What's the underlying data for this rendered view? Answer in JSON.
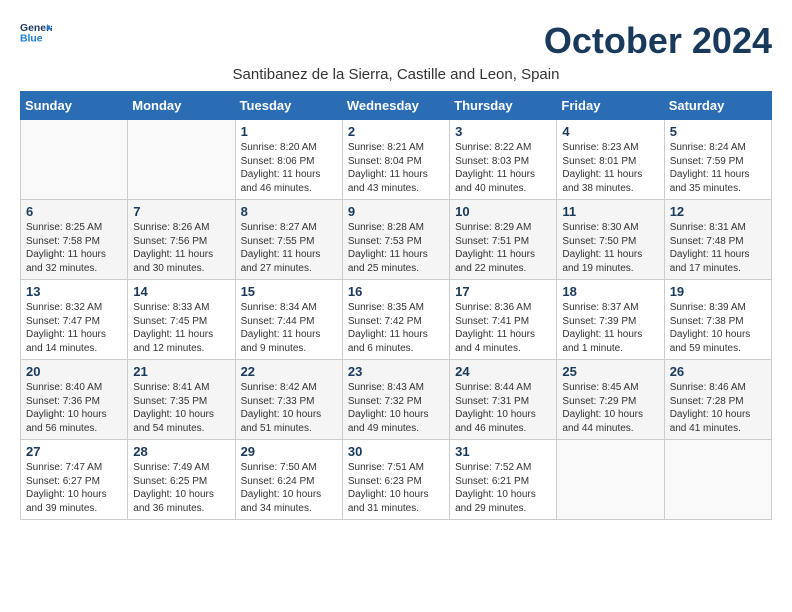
{
  "header": {
    "logo_general": "General",
    "logo_blue": "Blue",
    "month_title": "October 2024",
    "location": "Santibanez de la Sierra, Castille and Leon, Spain"
  },
  "days_of_week": [
    "Sunday",
    "Monday",
    "Tuesday",
    "Wednesday",
    "Thursday",
    "Friday",
    "Saturday"
  ],
  "weeks": [
    [
      {
        "day": "",
        "content": ""
      },
      {
        "day": "",
        "content": ""
      },
      {
        "day": "1",
        "content": "Sunrise: 8:20 AM\nSunset: 8:06 PM\nDaylight: 11 hours and 46 minutes."
      },
      {
        "day": "2",
        "content": "Sunrise: 8:21 AM\nSunset: 8:04 PM\nDaylight: 11 hours and 43 minutes."
      },
      {
        "day": "3",
        "content": "Sunrise: 8:22 AM\nSunset: 8:03 PM\nDaylight: 11 hours and 40 minutes."
      },
      {
        "day": "4",
        "content": "Sunrise: 8:23 AM\nSunset: 8:01 PM\nDaylight: 11 hours and 38 minutes."
      },
      {
        "day": "5",
        "content": "Sunrise: 8:24 AM\nSunset: 7:59 PM\nDaylight: 11 hours and 35 minutes."
      }
    ],
    [
      {
        "day": "6",
        "content": "Sunrise: 8:25 AM\nSunset: 7:58 PM\nDaylight: 11 hours and 32 minutes."
      },
      {
        "day": "7",
        "content": "Sunrise: 8:26 AM\nSunset: 7:56 PM\nDaylight: 11 hours and 30 minutes."
      },
      {
        "day": "8",
        "content": "Sunrise: 8:27 AM\nSunset: 7:55 PM\nDaylight: 11 hours and 27 minutes."
      },
      {
        "day": "9",
        "content": "Sunrise: 8:28 AM\nSunset: 7:53 PM\nDaylight: 11 hours and 25 minutes."
      },
      {
        "day": "10",
        "content": "Sunrise: 8:29 AM\nSunset: 7:51 PM\nDaylight: 11 hours and 22 minutes."
      },
      {
        "day": "11",
        "content": "Sunrise: 8:30 AM\nSunset: 7:50 PM\nDaylight: 11 hours and 19 minutes."
      },
      {
        "day": "12",
        "content": "Sunrise: 8:31 AM\nSunset: 7:48 PM\nDaylight: 11 hours and 17 minutes."
      }
    ],
    [
      {
        "day": "13",
        "content": "Sunrise: 8:32 AM\nSunset: 7:47 PM\nDaylight: 11 hours and 14 minutes."
      },
      {
        "day": "14",
        "content": "Sunrise: 8:33 AM\nSunset: 7:45 PM\nDaylight: 11 hours and 12 minutes."
      },
      {
        "day": "15",
        "content": "Sunrise: 8:34 AM\nSunset: 7:44 PM\nDaylight: 11 hours and 9 minutes."
      },
      {
        "day": "16",
        "content": "Sunrise: 8:35 AM\nSunset: 7:42 PM\nDaylight: 11 hours and 6 minutes."
      },
      {
        "day": "17",
        "content": "Sunrise: 8:36 AM\nSunset: 7:41 PM\nDaylight: 11 hours and 4 minutes."
      },
      {
        "day": "18",
        "content": "Sunrise: 8:37 AM\nSunset: 7:39 PM\nDaylight: 11 hours and 1 minute."
      },
      {
        "day": "19",
        "content": "Sunrise: 8:39 AM\nSunset: 7:38 PM\nDaylight: 10 hours and 59 minutes."
      }
    ],
    [
      {
        "day": "20",
        "content": "Sunrise: 8:40 AM\nSunset: 7:36 PM\nDaylight: 10 hours and 56 minutes."
      },
      {
        "day": "21",
        "content": "Sunrise: 8:41 AM\nSunset: 7:35 PM\nDaylight: 10 hours and 54 minutes."
      },
      {
        "day": "22",
        "content": "Sunrise: 8:42 AM\nSunset: 7:33 PM\nDaylight: 10 hours and 51 minutes."
      },
      {
        "day": "23",
        "content": "Sunrise: 8:43 AM\nSunset: 7:32 PM\nDaylight: 10 hours and 49 minutes."
      },
      {
        "day": "24",
        "content": "Sunrise: 8:44 AM\nSunset: 7:31 PM\nDaylight: 10 hours and 46 minutes."
      },
      {
        "day": "25",
        "content": "Sunrise: 8:45 AM\nSunset: 7:29 PM\nDaylight: 10 hours and 44 minutes."
      },
      {
        "day": "26",
        "content": "Sunrise: 8:46 AM\nSunset: 7:28 PM\nDaylight: 10 hours and 41 minutes."
      }
    ],
    [
      {
        "day": "27",
        "content": "Sunrise: 7:47 AM\nSunset: 6:27 PM\nDaylight: 10 hours and 39 minutes."
      },
      {
        "day": "28",
        "content": "Sunrise: 7:49 AM\nSunset: 6:25 PM\nDaylight: 10 hours and 36 minutes."
      },
      {
        "day": "29",
        "content": "Sunrise: 7:50 AM\nSunset: 6:24 PM\nDaylight: 10 hours and 34 minutes."
      },
      {
        "day": "30",
        "content": "Sunrise: 7:51 AM\nSunset: 6:23 PM\nDaylight: 10 hours and 31 minutes."
      },
      {
        "day": "31",
        "content": "Sunrise: 7:52 AM\nSunset: 6:21 PM\nDaylight: 10 hours and 29 minutes."
      },
      {
        "day": "",
        "content": ""
      },
      {
        "day": "",
        "content": ""
      }
    ]
  ]
}
